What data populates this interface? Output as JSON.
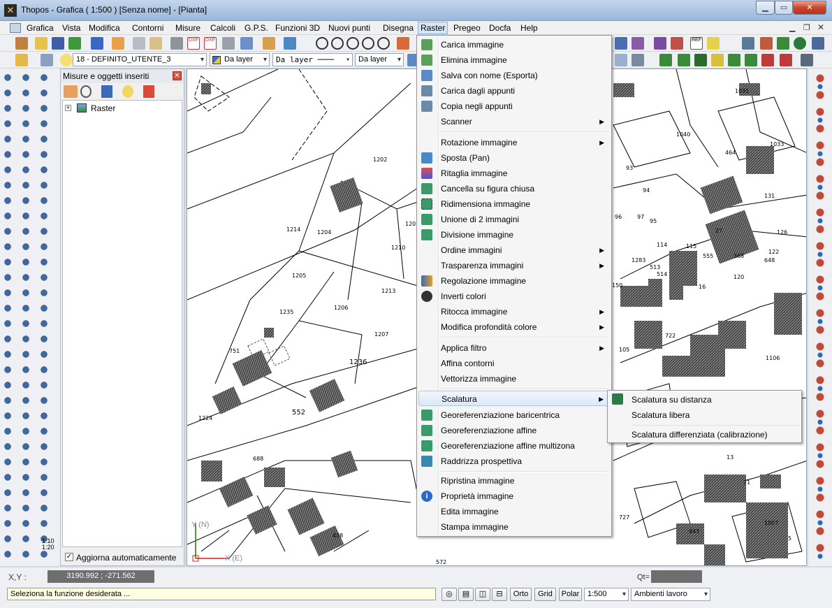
{
  "window": {
    "title": "Thopos - Grafica ( 1:500 ) [Senza nome] - [Pianta]"
  },
  "menubar": [
    "Grafica",
    "Vista",
    "Modifica",
    "Contorni",
    "Misure",
    "Calcoli",
    "G.P.S.",
    "Funzioni 3D",
    "Nuovi punti",
    "Disegna",
    "Raster",
    "Pregeo",
    "Docfa",
    "Help"
  ],
  "toolbar2": {
    "layer": "18 - DEFINITO_UTENTE_3",
    "color": "Da layer",
    "linetype": "Da layer",
    "linewidth": "Da layer"
  },
  "panel": {
    "title": "Misure e oggetti inseriti",
    "tree_item": "Raster",
    "auto_update": "Aggiorna automaticamente"
  },
  "raster_menu": {
    "items": [
      "Carica immagine",
      "Elimina immagine",
      "Salva con nome (Esporta)",
      "Carica dagli appunti",
      "Copia negli appunti",
      "Scanner",
      "Rotazione immagine",
      "Sposta (Pan)",
      "Ritaglia immagine",
      "Cancella su figura chiusa",
      "Ridimensiona immagine",
      "Unione di 2 immagini",
      "Divisione immagine",
      "Ordine immagini",
      "Trasparenza immagini",
      "Regolazione immagine",
      "Inverti colori",
      "Ritocca immagine",
      "Modifica profondità colore",
      "Applica filtro",
      "Affina contorni",
      "Vettorizza immagine",
      "Scalatura",
      "Georeferenziazione baricentrica",
      "Georeferenziazione affine",
      "Georeferenziazione affine multizona",
      "Raddrizza prospettiva",
      "Ripristina immagine",
      "Proprietà immagine",
      "Edita immagine",
      "Stampa immagine"
    ]
  },
  "scalatura_submenu": [
    "Scalatura su distanza",
    "Scalatura libera",
    "Scalatura differenziata (calibrazione)"
  ],
  "map": {
    "axis_y": "Y (N)",
    "axis_x": "X (E)",
    "labels": [
      "1202",
      "1204",
      "1205",
      "1206",
      "1207",
      "1210",
      "1213",
      "1214",
      "1235",
      "1236",
      "751",
      "552",
      "1224",
      "688",
      "458",
      "572",
      "1031",
      "1040",
      "1033",
      "464",
      "131",
      "93",
      "94",
      "97",
      "96",
      "95",
      "114",
      "115",
      "27",
      "126",
      "122",
      "513",
      "514",
      "1283",
      "555",
      "368",
      "120",
      "648",
      "16",
      "150",
      "105",
      "722",
      "1106",
      "13",
      "71",
      "727",
      "1007",
      "943",
      "5",
      "1205"
    ]
  },
  "status": {
    "xy_label": "X,Y :",
    "xy_value": "3190.992 ; -271.562",
    "qt_label": "Qt=",
    "message": "Seleziona la funzione desiderata ...",
    "buttons": [
      "Orto",
      "Grid",
      "Polar"
    ],
    "scale": "1:500",
    "workspace": "Ambienti lavoro"
  },
  "colors": {
    "accent": "#d6e6f7",
    "menu_bg": "#f5f5f5",
    "hatch": "#333333"
  }
}
